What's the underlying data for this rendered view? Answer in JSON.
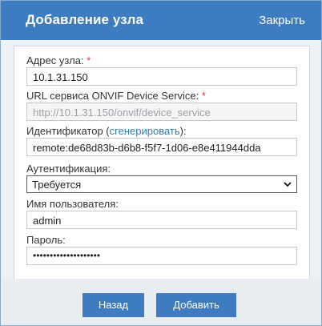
{
  "dialog": {
    "title": "Добавление узла",
    "close_label": "Закрыть"
  },
  "form": {
    "address": {
      "label": "Адрес узла:",
      "required_mark": "*",
      "value": "10.1.31.150"
    },
    "onvif_url": {
      "label": "URL сервиса ONVIF Device Service:",
      "required_mark": "*",
      "value": "http://10.1.31.150/onvif/device_service"
    },
    "identifier": {
      "label_prefix": "Идентификатор (",
      "generate_link": "сгенерировать",
      "label_suffix": "):",
      "value": "remote:de68d83b-d6b8-f5f7-1d06-e8e411944dda"
    },
    "auth": {
      "label": "Аутентификация:",
      "selected": "Требуется"
    },
    "username": {
      "label": "Имя пользователя:",
      "value": "admin"
    },
    "password": {
      "label": "Пароль:",
      "masked_value": "••••••••••••••••••••"
    }
  },
  "buttons": {
    "back_label": "Назад",
    "add_label": "Добавить"
  },
  "colors": {
    "header_blue": "#3d7cc1",
    "required_red": "#d9363e",
    "link_blue": "#2f7ab6"
  }
}
